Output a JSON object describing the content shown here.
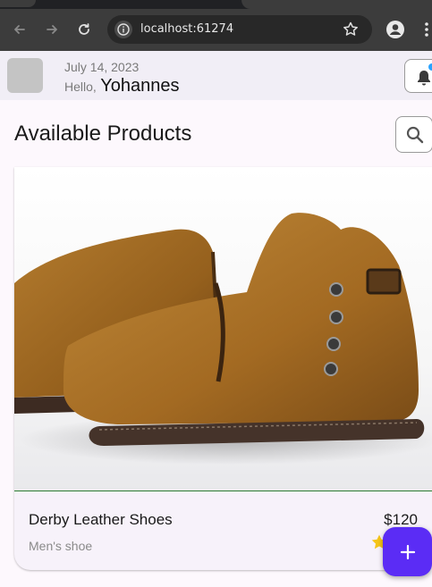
{
  "browser": {
    "url": "localhost:61274",
    "icons": {
      "back": "arrow-left-icon",
      "forward": "arrow-right-icon",
      "reload": "reload-icon",
      "info": "info-icon",
      "bookmark": "star-outline-icon",
      "profile": "account-icon",
      "menu": "kebab-menu-icon"
    }
  },
  "header": {
    "date": "July 14, 2023",
    "greeting": "Hello,",
    "user_name": "Yohannes",
    "notification_icon": "bell-icon",
    "notification_dot_color": "#2aa3ff"
  },
  "main": {
    "title": "Available Products",
    "search_icon": "search-icon",
    "products": [
      {
        "name": "Derby Leather Shoes",
        "category": "Men's shoe",
        "price": "$120",
        "image": "tan-leather-ankle-boots",
        "rating_icon": "star-icon"
      }
    ],
    "fab_icon": "plus-icon",
    "fab_color": "#5b2cf5"
  }
}
